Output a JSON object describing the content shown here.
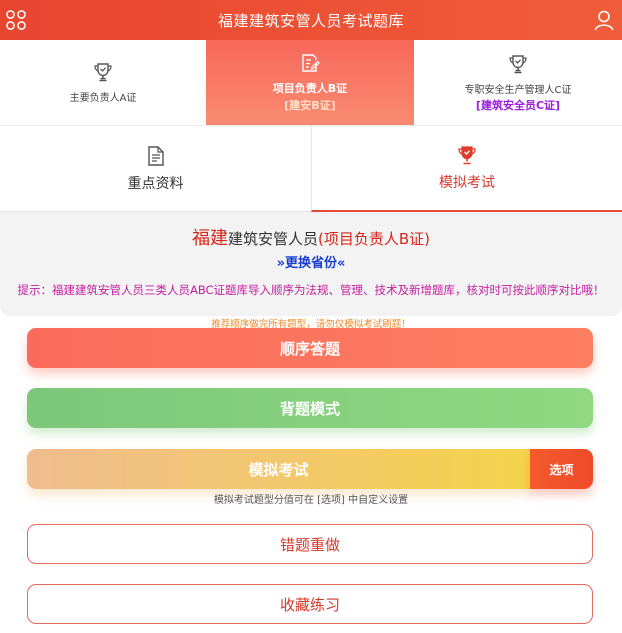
{
  "header": {
    "title": "福建建筑安管人员考试题库"
  },
  "cert_tabs": [
    {
      "label": "主要负责人A证",
      "sub": ""
    },
    {
      "label": "项目负责人B证",
      "sub": "[建安B证]"
    },
    {
      "label": "专职安全生产管理人C证",
      "sub": "[建筑安全员C证]"
    }
  ],
  "section_tabs": [
    {
      "label": "重点资料"
    },
    {
      "label": "模拟考试"
    }
  ],
  "info": {
    "province": "福建",
    "category": "建筑安管人员",
    "cert": "(项目负责人B证)",
    "change_province": "»更换省份«",
    "tip": "提示：福建建筑安管人员三类人员ABC证题库导入顺序为法规、管理、技术及新增题库，核对时可按此顺序对比哦！"
  },
  "hint": "推荐顺序做完所有题型，请勿仅模拟考试刷题！",
  "buttons": {
    "sequential": "顺序答题",
    "recite": "背题模式",
    "exam": "模拟考试",
    "options": "选项",
    "exam_note": "模拟考试题型分值可在 [选项] 中自定义设置",
    "wrong": "错题重做",
    "favorites": "收藏练习"
  },
  "colors": {
    "header": "#e8452f",
    "active_tab": "#f8685a",
    "province": "#d8261a",
    "link": "#1a3fd0",
    "tip": "#c21ea0",
    "hint": "#f08c2a",
    "c_cert": "#9a1fd8"
  },
  "icons": {
    "menu": "grid-circles-icon",
    "user": "user-icon",
    "cert_a": "trophy-icon",
    "cert_b": "edit-document-icon",
    "cert_c": "trophy-icon",
    "materials": "document-icon",
    "exam": "trophy-icon"
  }
}
